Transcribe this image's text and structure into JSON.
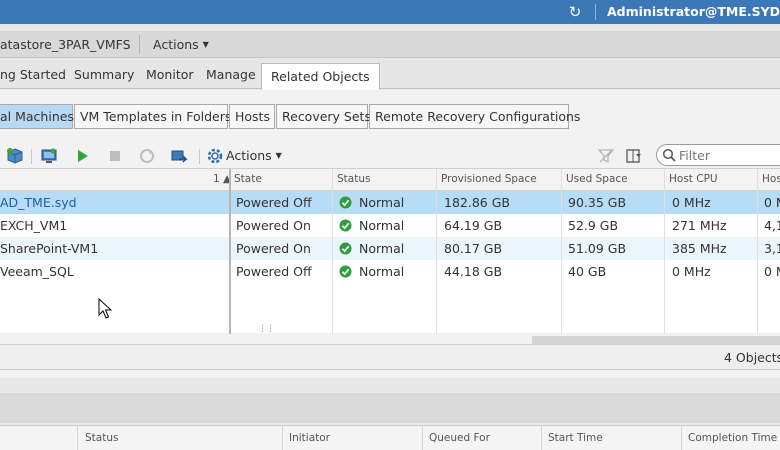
{
  "topbar": {
    "refresh_icon": "refresh-icon",
    "user": "Administrator@TME.SYD"
  },
  "object_bar": {
    "title": "atastore_3PAR_VMFS",
    "actions": "Actions"
  },
  "tabs": [
    {
      "label": "ng Started",
      "active": false
    },
    {
      "label": "Summary",
      "active": false
    },
    {
      "label": "Monitor",
      "active": false
    },
    {
      "label": "Manage",
      "active": false
    },
    {
      "label": "Related Objects",
      "active": true
    }
  ],
  "subtabs": [
    {
      "label": "al Machines",
      "active": true
    },
    {
      "label": "VM Templates in Folders",
      "active": false
    },
    {
      "label": "Hosts",
      "active": false
    },
    {
      "label": "Recovery Sets",
      "active": false
    },
    {
      "label": "Remote Recovery Configurations",
      "active": false
    }
  ],
  "toolbar": {
    "actions_label": "Actions",
    "filter_placeholder": "Filter",
    "icons": [
      "new-vm-icon",
      "console-icon",
      "power-on-icon",
      "power-off-icon",
      "refresh-disabled-icon",
      "migrate-icon",
      "gear-icon",
      "clear-filter-icon",
      "export-icon",
      "search-icon"
    ]
  },
  "grid": {
    "sort_indicator": "1 ▲",
    "columns": [
      "State",
      "Status",
      "Provisioned Space",
      "Used Space",
      "Host CPU",
      "Hos"
    ],
    "rows": [
      {
        "name": "AD_TME.syd",
        "state": "Powered Off",
        "status": "Normal",
        "provisioned": "182.86  GB",
        "used": "90.35  GB",
        "cpu": "0 MHz",
        "host": "0 M"
      },
      {
        "name": "EXCH_VM1",
        "state": "Powered On",
        "status": "Normal",
        "provisioned": "64.19  GB",
        "used": "52.9  GB",
        "cpu": "271 MHz",
        "host": "4,1"
      },
      {
        "name": "SharePoint-VM1",
        "state": "Powered On",
        "status": "Normal",
        "provisioned": "80.17  GB",
        "used": "51.09  GB",
        "cpu": "385 MHz",
        "host": "3,1"
      },
      {
        "name": "Veeam_SQL",
        "state": "Powered Off",
        "status": "Normal",
        "provisioned": "44.18  GB",
        "used": "40  GB",
        "cpu": "0 MHz",
        "host": "0 M"
      }
    ],
    "count": "4 Objects"
  },
  "tasks": {
    "columns": [
      "Status",
      "Initiator",
      "Queued For",
      "Start Time",
      "Completion Time"
    ]
  },
  "colors": {
    "topbar": "#3b78b5",
    "selected_row": "#b7dcf5",
    "status_green": "#2e9e3c"
  }
}
